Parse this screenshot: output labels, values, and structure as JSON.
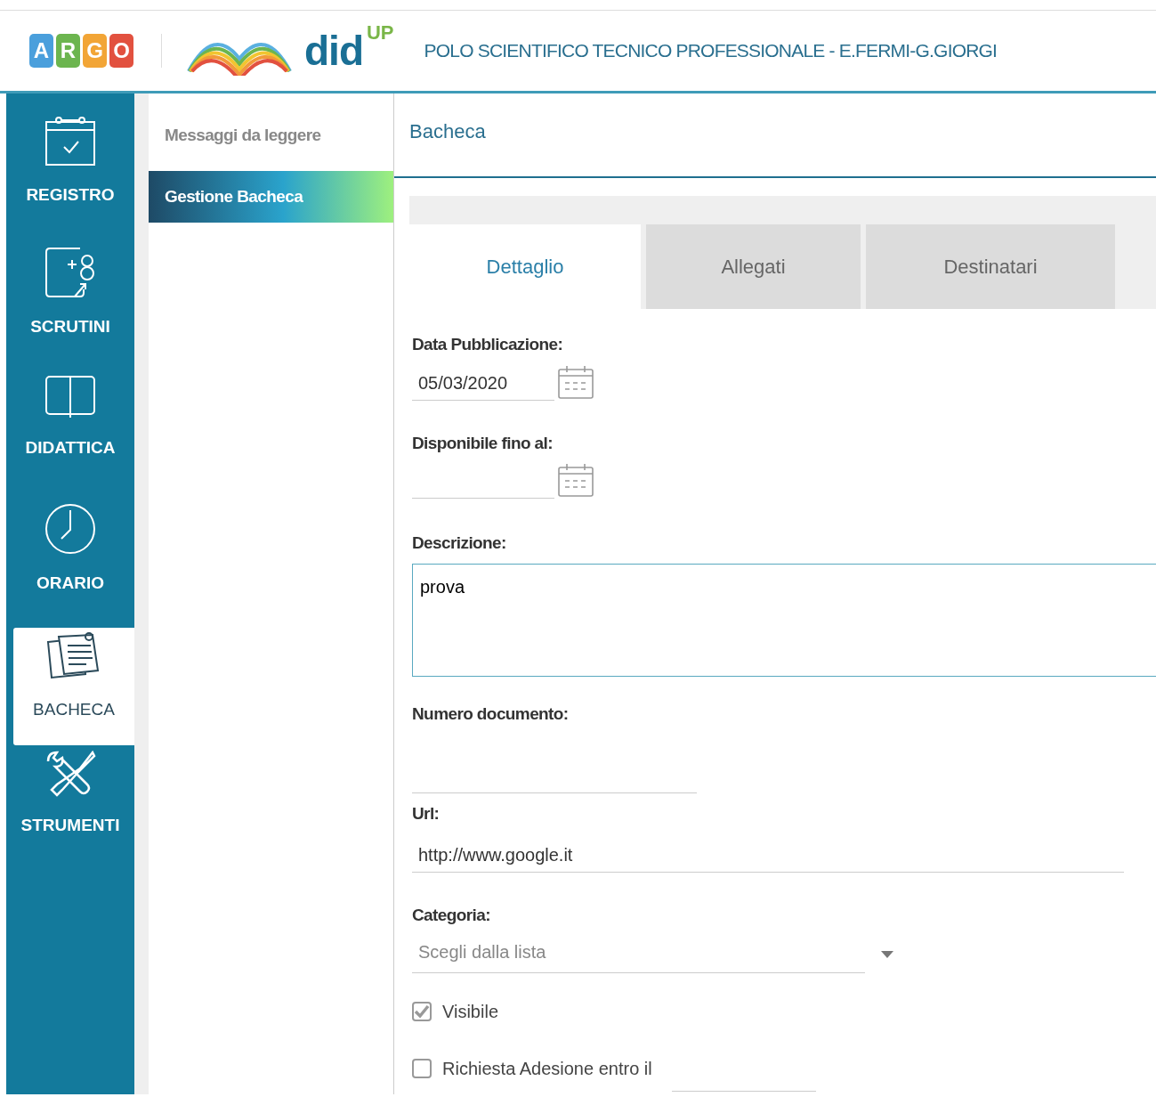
{
  "header": {
    "logo_letters": [
      {
        "text": "A",
        "color": "#4a9fdc"
      },
      {
        "text": "R",
        "color": "#6cb54f"
      },
      {
        "text": "G",
        "color": "#f2a536"
      },
      {
        "text": "O",
        "color": "#e2513f"
      }
    ],
    "brand": "did",
    "brand_sup": "UP",
    "school": "POLO SCIENTIFICO TECNICO PROFESSIONALE - E.FERMI-G.GIORGI"
  },
  "nav": [
    {
      "label": "REGISTRO",
      "selected": false
    },
    {
      "label": "SCRUTINI",
      "selected": false
    },
    {
      "label": "DIDATTICA",
      "selected": false
    },
    {
      "label": "ORARIO",
      "selected": false
    },
    {
      "label": "BACHECA",
      "selected": true
    },
    {
      "label": "STRUMENTI",
      "selected": false
    }
  ],
  "submenu": [
    {
      "label": "Messaggi da leggere",
      "selected": false
    },
    {
      "label": "Gestione Bacheca",
      "selected": true
    }
  ],
  "panel_title": "Bacheca",
  "tabs": [
    {
      "label": "Dettaglio",
      "selected": true
    },
    {
      "label": "Allegati",
      "selected": false
    },
    {
      "label": "Destinatari",
      "selected": false
    }
  ],
  "form": [
    {
      "kind": "date",
      "label": "Data Pubblicazione:",
      "value": "05/03/2020"
    },
    {
      "kind": "date",
      "label": "Disponibile fino al:"
    },
    {
      "kind": "textarea",
      "label": "Descrizione:",
      "value": "prova"
    },
    {
      "kind": "text",
      "label": "Numero documento:"
    },
    {
      "kind": "url",
      "label": "Url:",
      "value": "http://www.google.it"
    },
    {
      "kind": "select",
      "label": "Categoria:",
      "placeholder": "Scegli dalla lista"
    },
    {
      "kind": "checkbox",
      "label": "Visibile",
      "checked": true
    },
    {
      "kind": "checkbox_date",
      "label": "Richiesta Adesione entro il",
      "checked": false
    }
  ]
}
